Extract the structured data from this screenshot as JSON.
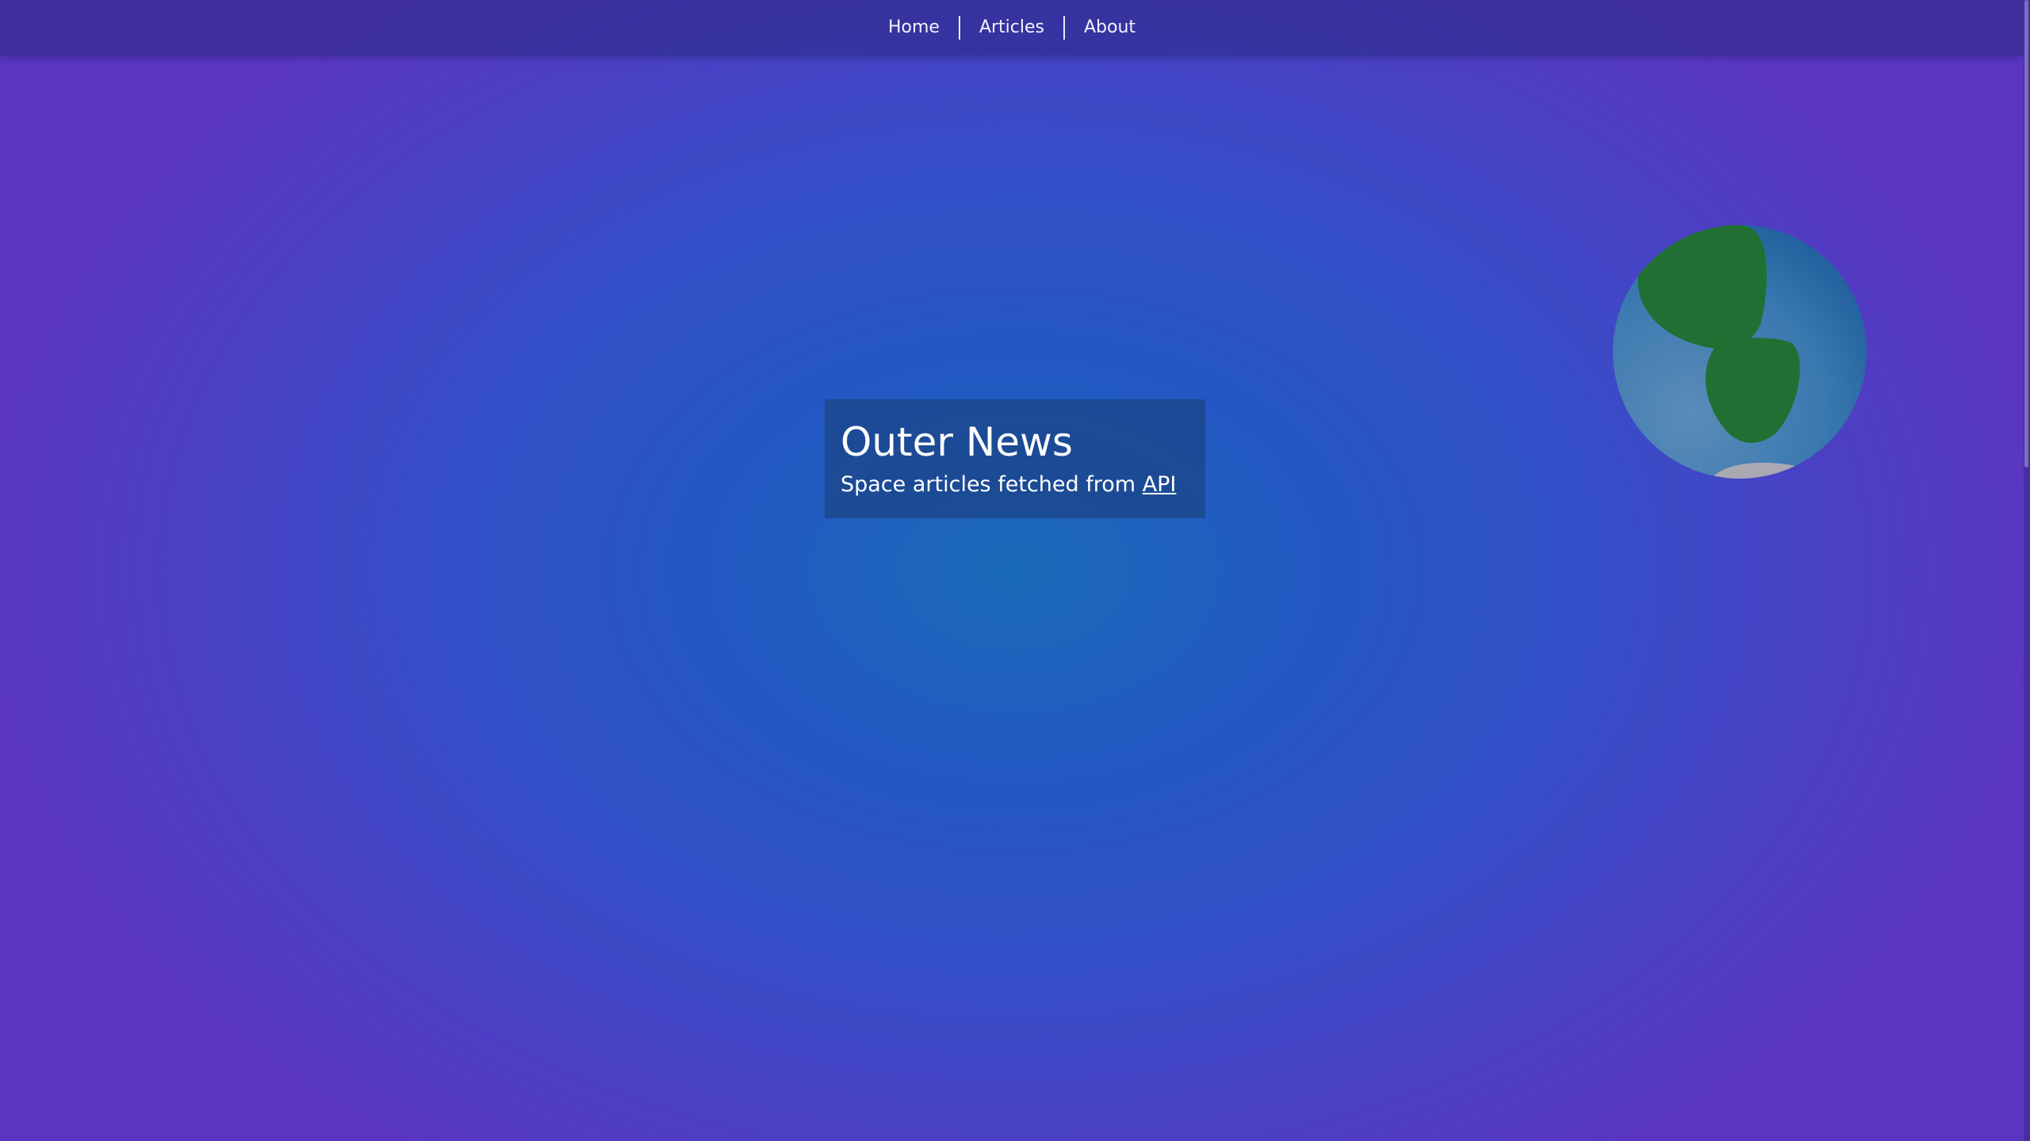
{
  "nav": {
    "items": [
      {
        "label": "Home"
      },
      {
        "label": "Articles"
      },
      {
        "label": "About"
      }
    ]
  },
  "hero": {
    "title": "Outer News",
    "subtitle_prefix": "Space articles fetched from ",
    "subtitle_link": "API"
  },
  "decor": {
    "globe_icon": "earth-globe-icon"
  },
  "colors": {
    "background_center": "#1a6ab8",
    "background_edge": "#5a36c0",
    "hero_panel": "#1c488e",
    "globe_ocean": "#3a78b0",
    "globe_land": "#217033",
    "globe_ice": "#a9a9b4"
  }
}
